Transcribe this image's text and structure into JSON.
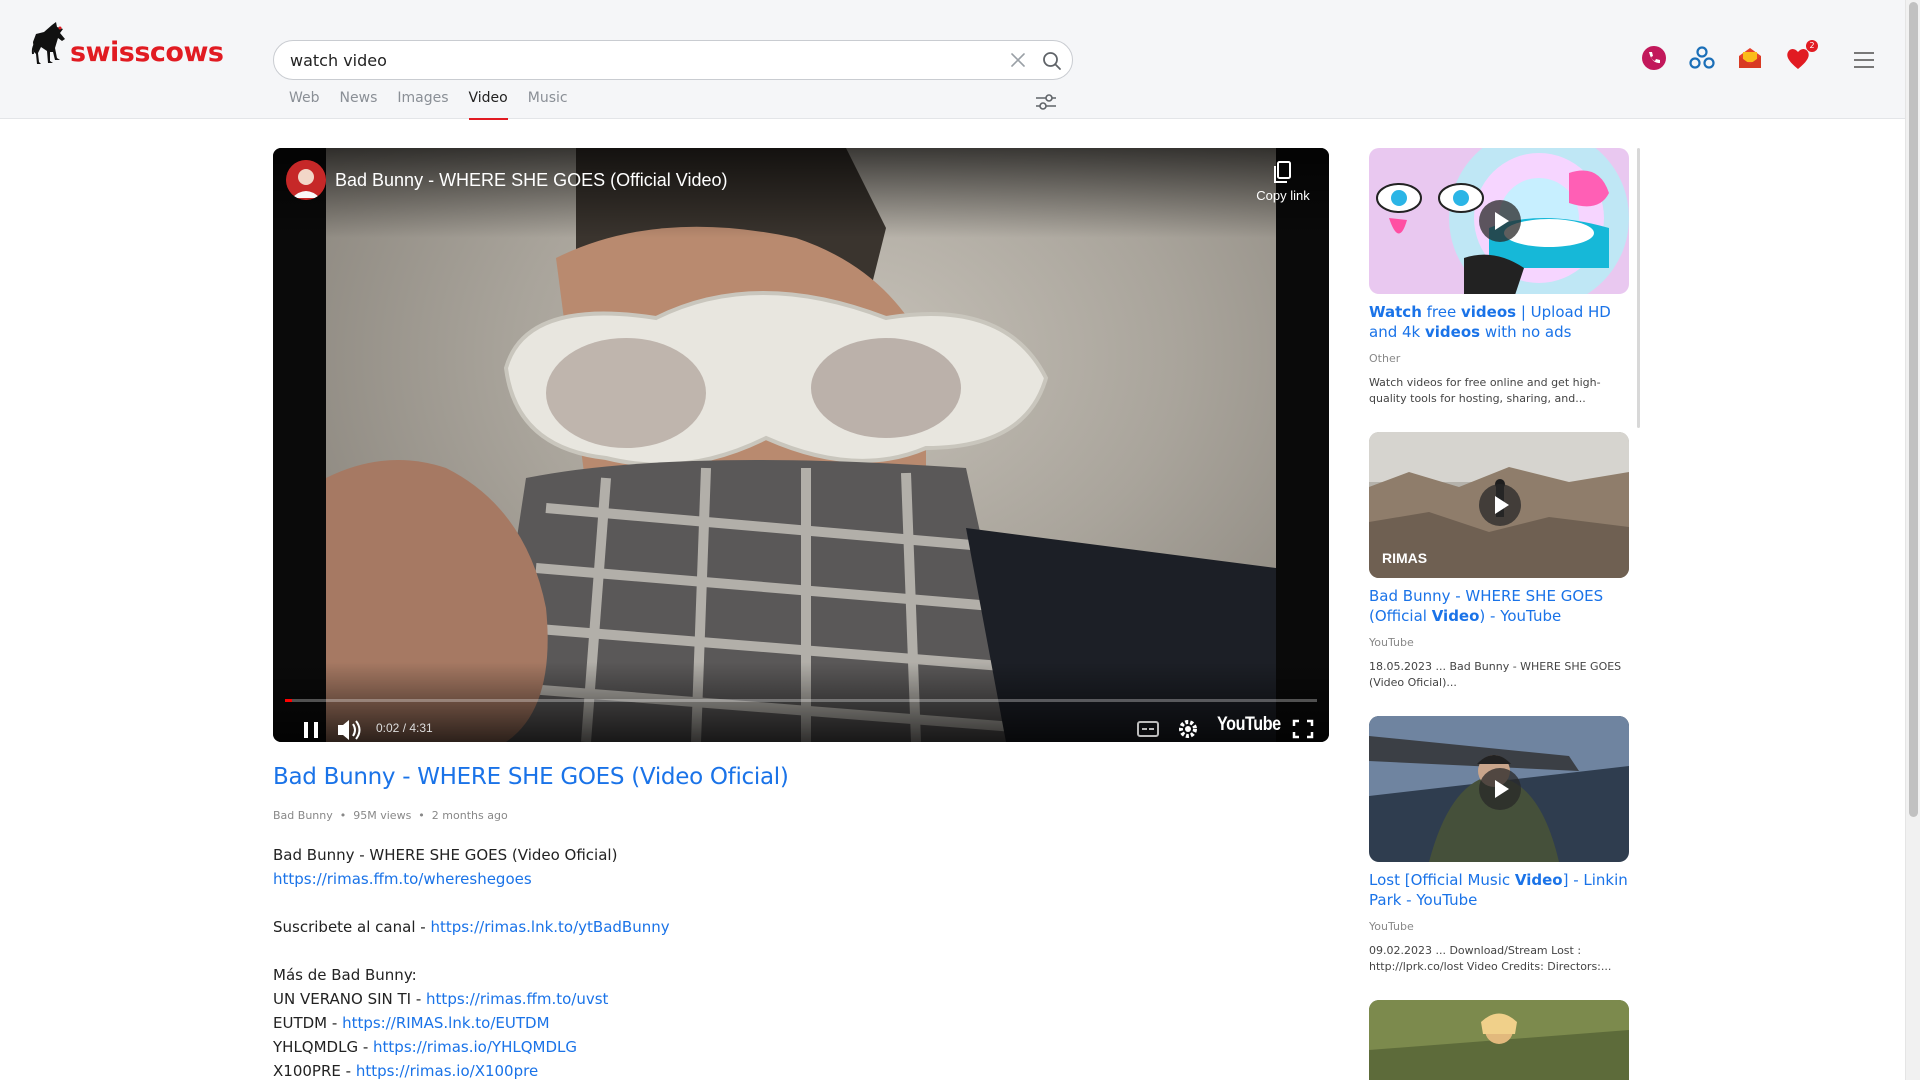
{
  "logo": {
    "text": "swisscows"
  },
  "search": {
    "value": "watch video",
    "placeholder": ""
  },
  "tabs": [
    {
      "label": "Web"
    },
    {
      "label": "News"
    },
    {
      "label": "Images"
    },
    {
      "label": "Video",
      "active": true
    },
    {
      "label": "Music"
    }
  ],
  "header_icons": [
    {
      "name": "vpn-icon"
    },
    {
      "name": "teleguard-icon"
    },
    {
      "name": "mail-icon"
    },
    {
      "name": "heart-icon",
      "badge": "2"
    },
    {
      "name": "menu-icon"
    }
  ],
  "colors": {
    "accent_red": "#e11b22",
    "link_blue": "#1a73e8"
  },
  "player": {
    "title": "Bad Bunny - WHERE SHE GOES (Official Video)",
    "copy_link": "Copy link",
    "time": "0:02 / 4:31",
    "progress_fraction": 0.007,
    "brand": "YouTube"
  },
  "video": {
    "title": "Bad Bunny - WHERE SHE GOES (Video Oficial)",
    "channel": "Bad Bunny",
    "views": "95M views",
    "age": "2 months ago"
  },
  "description": {
    "line1": "Bad Bunny - WHERE SHE GOES (Video Oficial)",
    "link1": "https://rimas.ffm.to/whereshegoes",
    "subscribe_label": "Suscribete al canal - ",
    "subscribe_link": "https://rimas.lnk.to/ytBadBunny",
    "more_label": "Más de Bad Bunny:",
    "items": [
      {
        "label": "UN VERANO SIN TI - ",
        "link": "https://rimas.ffm.to/uvst"
      },
      {
        "label": "EUTDM - ",
        "link": "https://RIMAS.lnk.to/EUTDM"
      },
      {
        "label": "YHLQMDLG - ",
        "link": "https://rimas.io/YHLQMDLG"
      },
      {
        "label": "X100PRE - ",
        "link": "https://rimas.io/X100pre"
      }
    ]
  },
  "sidebar": {
    "cards": [
      {
        "title_parts": [
          "Watch",
          " free ",
          "videos",
          " | Upload HD and 4k ",
          "videos",
          " with no ads"
        ],
        "source": "Other",
        "snippet": "Watch videos for free online and get high-quality tools for hosting, sharing, and..."
      },
      {
        "title_parts": [
          "",
          "Bad Bunny - WHERE SHE GOES (Official ",
          "Video",
          ") - YouTube",
          "",
          ""
        ],
        "source": "YouTube",
        "snippet": "18.05.2023 ... Bad Bunny - WHERE SHE GOES (Video Oficial)...",
        "thumb_label": "RIMAS"
      },
      {
        "title_parts": [
          "",
          "Lost [Official Music ",
          "Video",
          "] - Linkin Park - YouTube",
          "",
          ""
        ],
        "source": "YouTube",
        "snippet": "09.02.2023 ... Download/Stream Lost : http://lprk.co/lost Video Credits: Directors:..."
      }
    ]
  }
}
